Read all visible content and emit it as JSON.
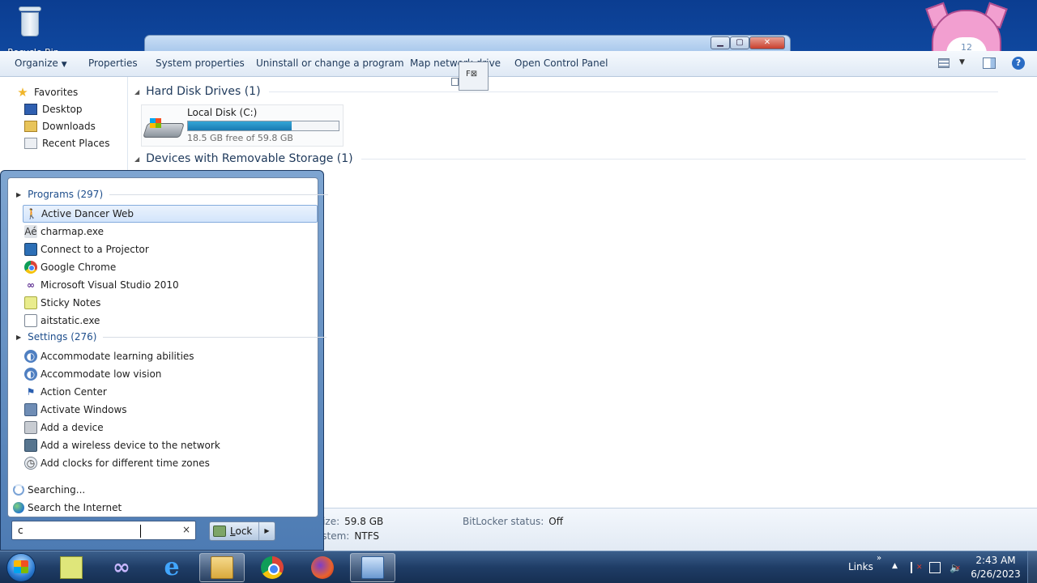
{
  "desktop": {
    "recycle_bin_label": "Recycle Bin",
    "widget_clock_text": "12"
  },
  "window": {
    "min_glyph": "▁",
    "max_glyph": "▢",
    "close_glyph": "✕"
  },
  "toolbar": {
    "organize": "Organize",
    "properties": "Properties",
    "system_properties": "System properties",
    "uninstall": "Uninstall or change a program",
    "map_network": "Map network drive",
    "open_control_panel": "Open Control Panel",
    "help_glyph": "?"
  },
  "drag_ghost_text": "F⊠",
  "nav": {
    "favorites": "Favorites",
    "desktop": "Desktop",
    "downloads": "Downloads",
    "recent_places": "Recent Places"
  },
  "content": {
    "hard_disk_header": "Hard Disk Drives (1)",
    "removable_header": "Devices with Removable Storage (1)",
    "drive": {
      "name": "Local Disk (C:)",
      "free_text": "18.5 GB free of 59.8 GB",
      "used_fraction": 0.69
    }
  },
  "details": {
    "total_size_key": "Total size:",
    "total_size_value": "59.8 GB",
    "filesystem_key": "File system:",
    "filesystem_value": "NTFS",
    "bitlocker_key": "BitLocker status:",
    "bitlocker_value": "Off"
  },
  "start_menu": {
    "programs_header": "Programs (297)",
    "programs": [
      "Active Dancer Web",
      "charmap.exe",
      "Connect to a Projector",
      "Google Chrome",
      "Microsoft Visual Studio 2010",
      "Sticky Notes",
      "aitstatic.exe"
    ],
    "settings_header": "Settings (276)",
    "settings": [
      "Accommodate learning abilities",
      "Accommodate low vision",
      "Action Center",
      "Activate Windows",
      "Add a device",
      "Add a wireless device to the network",
      "Add clocks for different time zones"
    ],
    "searching": "Searching...",
    "search_internet": "Search the Internet",
    "search_value": "c",
    "clear_glyph": "×",
    "lock_label": "Lock",
    "lock_arrow": "▶"
  },
  "taskbar": {
    "links": "Links",
    "chevron": "»",
    "tray_up": "▲",
    "time": "2:43 AM",
    "date": "6/26/2023"
  },
  "icons": [
    "recycle-bin-icon",
    "favorites-star-icon",
    "desktop-icon",
    "downloads-icon",
    "recent-places-icon",
    "drive-icon",
    "dancer-icon",
    "charmap-icon",
    "projector-icon",
    "chrome-icon",
    "visual-studio-icon",
    "sticky-notes-icon",
    "exe-icon",
    "ease-of-access-icon",
    "action-center-flag-icon",
    "activate-windows-icon",
    "device-icon",
    "wireless-icon",
    "clock-icon",
    "search-progress-icon",
    "globe-icon",
    "lock-icon",
    "start-orb-icon",
    "internet-explorer-icon",
    "folder-icon",
    "firefox-icon",
    "control-panel-icon",
    "power-icon",
    "speaker-icon"
  ],
  "colors": {
    "accent": "#1e395b",
    "selection": "#d3e5fb",
    "drive_fill": "#1a7bb2",
    "taskbar": "#1f3d66"
  }
}
